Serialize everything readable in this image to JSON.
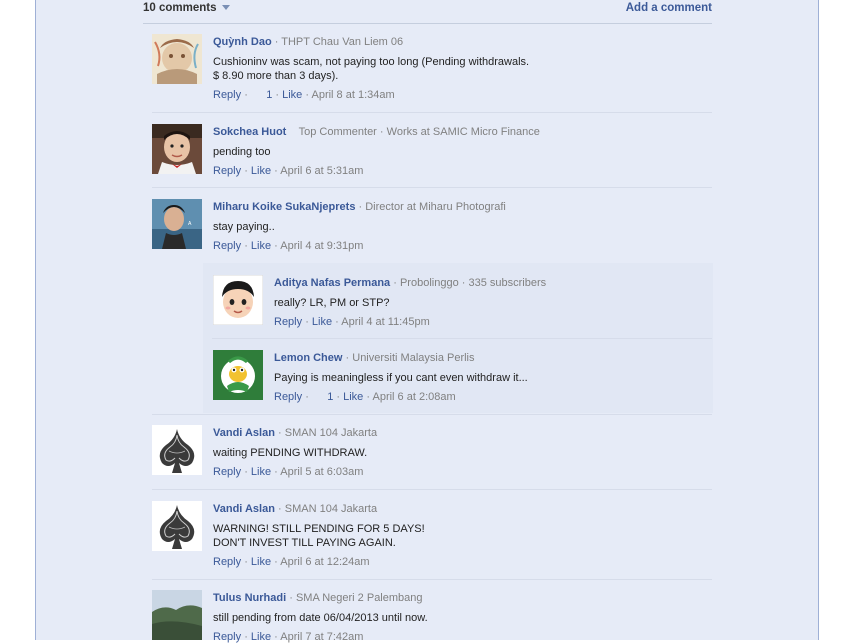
{
  "header": {
    "count_label": "10 comments",
    "add_label": "Add a comment"
  },
  "labels": {
    "reply": "Reply",
    "like": "Like",
    "dot": "·"
  },
  "comments": [
    {
      "name": "Quỳnh Dao",
      "meta": "THPT Chau Van Liem 06",
      "text": "Cushioninv was scam, not paying too long (Pending withdrawals.\n$ 8.90 more than 3 days).",
      "likes": "1",
      "time": "April 8 at 1:34am"
    },
    {
      "name": "Sokchea Huot",
      "badge": "Top Commenter",
      "meta": "Works at SAMIC Micro Finance",
      "text": "pending too",
      "time": "April 6 at 5:31am"
    },
    {
      "name": "Miharu Koike SukaNjeprets",
      "meta": "Director at Miharu Photografi",
      "text": "stay paying..",
      "time": "April 4 at 9:31pm"
    },
    {
      "name": "Aditya Nafas Permana",
      "meta": "Probolinggo",
      "meta2": "335 subscribers",
      "text": "really? LR, PM or STP?",
      "time": "April 4 at 11:45pm"
    },
    {
      "name": "Lemon Chew",
      "meta": "Universiti Malaysia Perlis",
      "text": "Paying is meaningless if you cant even withdraw it...",
      "likes": "1",
      "time": "April 6 at 2:08am"
    },
    {
      "name": "Vandi Aslan",
      "meta": "SMAN 104 Jakarta",
      "text": "waiting PENDING WITHDRAW.",
      "time": "April 5 at 6:03am"
    },
    {
      "name": "Vandi Aslan",
      "meta": "SMAN 104 Jakarta",
      "text": "WARNING! STILL PENDING FOR 5 DAYS!\nDON'T INVEST TILL PAYING AGAIN.",
      "time": "April 6 at 12:24am"
    },
    {
      "name": "Tulus Nurhadi",
      "meta": "SMA Negeri 2 Palembang",
      "text": "still pending from date 06/04/2013 until now.",
      "time": "April 7 at 7:42am"
    }
  ]
}
